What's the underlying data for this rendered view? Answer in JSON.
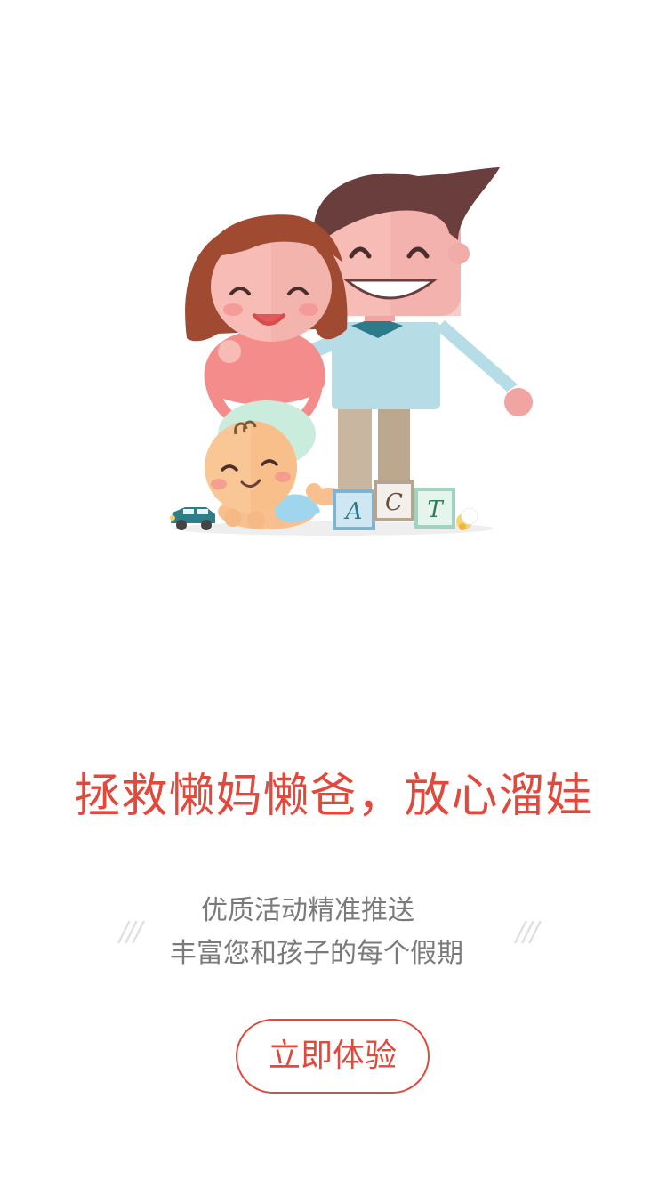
{
  "illustration": {
    "block_letters": [
      "A",
      "C",
      "T"
    ]
  },
  "headline": "拯救懒妈懒爸，放心溜娃",
  "subtitle": {
    "line1": "优质活动精准推送",
    "line2": "丰富您和孩子的每个假期",
    "decoration": "///"
  },
  "cta": {
    "label": "立即体验"
  },
  "colors": {
    "accent": "#e1493d",
    "subtitle_text": "#7a7a7a"
  }
}
